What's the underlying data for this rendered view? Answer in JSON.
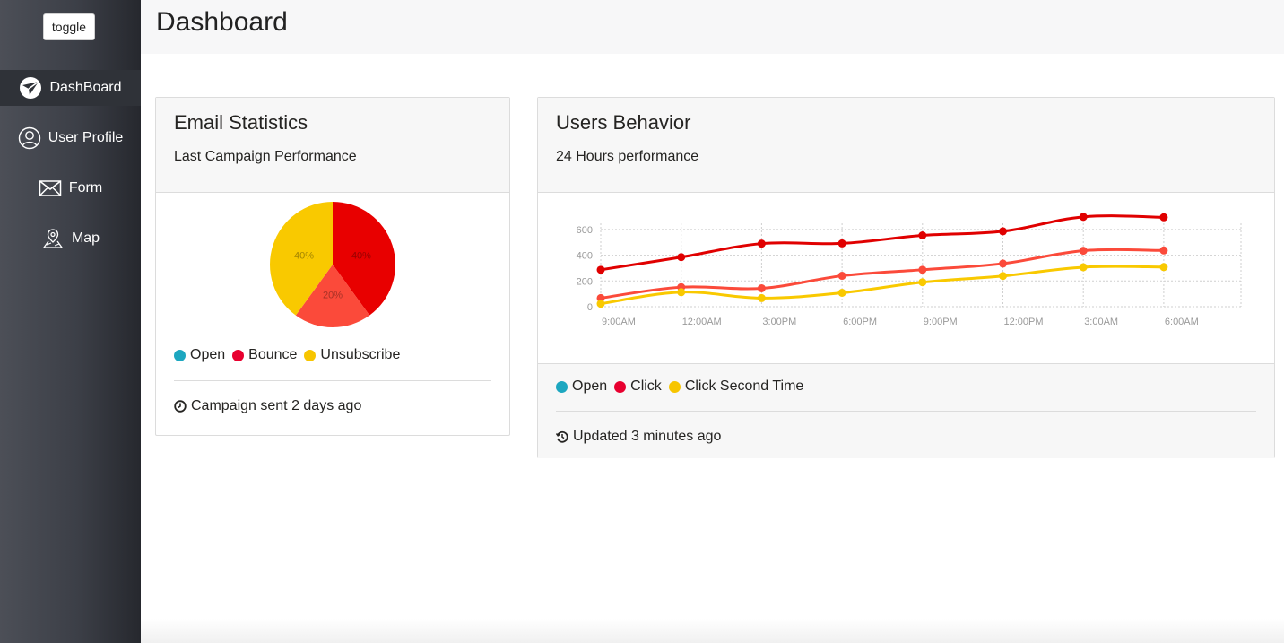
{
  "sidebar": {
    "toggle_label": "toggle",
    "items": [
      {
        "label": "DashBoard",
        "icon": "paper-plane-icon",
        "active": true
      },
      {
        "label": "User Profile",
        "icon": "user-circle-icon",
        "active": false
      },
      {
        "label": "Form",
        "icon": "envelope-icon",
        "active": false
      },
      {
        "label": "Map",
        "icon": "map-pin-icon",
        "active": false
      }
    ]
  },
  "header": {
    "title": "Dashboard"
  },
  "email_card": {
    "title": "Email Statistics",
    "subtitle": "Last Campaign Performance",
    "legend": [
      {
        "label": "Open",
        "color": "#1da7c0"
      },
      {
        "label": "Bounce",
        "color": "#e8002f"
      },
      {
        "label": "Unsubscribe",
        "color": "#f7c500"
      }
    ],
    "footer": "Campaign sent 2 days ago",
    "footer_icon": "clock-icon"
  },
  "users_card": {
    "title": "Users Behavior",
    "subtitle": "24 Hours performance",
    "legend": [
      {
        "label": "Open",
        "color": "#1da7c0"
      },
      {
        "label": "Click",
        "color": "#e8002f"
      },
      {
        "label": "Click Second Time",
        "color": "#f7c500"
      }
    ],
    "footer": "Updated 3 minutes ago",
    "footer_icon": "history-icon"
  },
  "chart_data": [
    {
      "type": "pie",
      "categories": [
        "40%",
        "20%",
        "40%"
      ],
      "values": [
        40,
        20,
        40
      ],
      "colors": [
        "#e80000",
        "#fb4a3a",
        "#f9c900"
      ],
      "labels": [
        "40%",
        "20%",
        "40%"
      ]
    },
    {
      "type": "line",
      "x": [
        "9:00AM",
        "12:00AM",
        "3:00PM",
        "6:00PM",
        "9:00PM",
        "12:00PM",
        "3:00AM",
        "6:00AM"
      ],
      "ylim": [
        0,
        700
      ],
      "yticks": [
        0,
        200,
        400,
        600
      ],
      "grid": true,
      "series": [
        {
          "color": "#e00000",
          "values": [
            287,
            385,
            490,
            492,
            554,
            586,
            698,
            695
          ]
        },
        {
          "color": "#fb4a3a",
          "values": [
            67,
            152,
            143,
            240,
            287,
            335,
            435,
            437
          ]
        },
        {
          "color": "#f9c900",
          "values": [
            23,
            113,
            67,
            108,
            190,
            239,
            307,
            308
          ]
        }
      ]
    }
  ]
}
